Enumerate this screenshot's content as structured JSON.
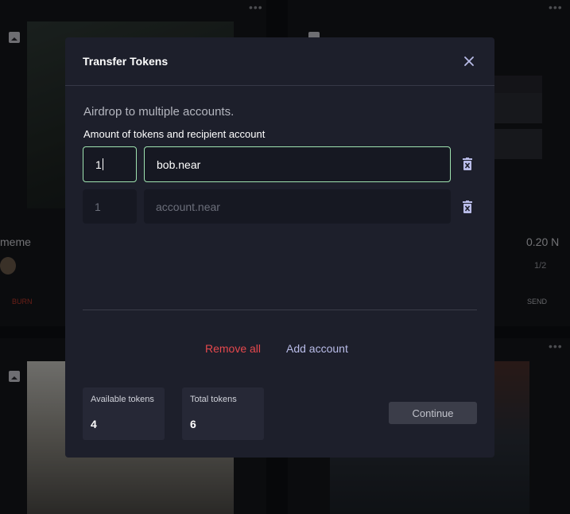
{
  "background": {
    "cards": [
      {
        "name_text": "meme",
        "price": "0.20 N",
        "pagination": "1/2",
        "burn_label": "BURN",
        "send_label": "SEND"
      }
    ]
  },
  "modal": {
    "title": "Transfer Tokens",
    "close_icon": "close-icon",
    "subtitle": "Airdrop to multiple accounts.",
    "field_label": "Amount of tokens and recipient account",
    "rows": [
      {
        "amount": "1",
        "account": "bob.near",
        "amount_placeholder": "",
        "account_placeholder": ""
      },
      {
        "amount": "",
        "account": "",
        "amount_placeholder": "1",
        "account_placeholder": "account.near"
      }
    ],
    "remove_all_label": "Remove all",
    "add_account_label": "Add account",
    "available_label": "Available tokens",
    "available_value": "4",
    "total_label": "Total tokens",
    "total_value": "6",
    "continue_label": "Continue"
  },
  "colors": {
    "modal_bg": "#1d1f2b",
    "accent_link": "#b9bce8",
    "danger": "#e5484d",
    "active_border": "#9fe3b0"
  }
}
